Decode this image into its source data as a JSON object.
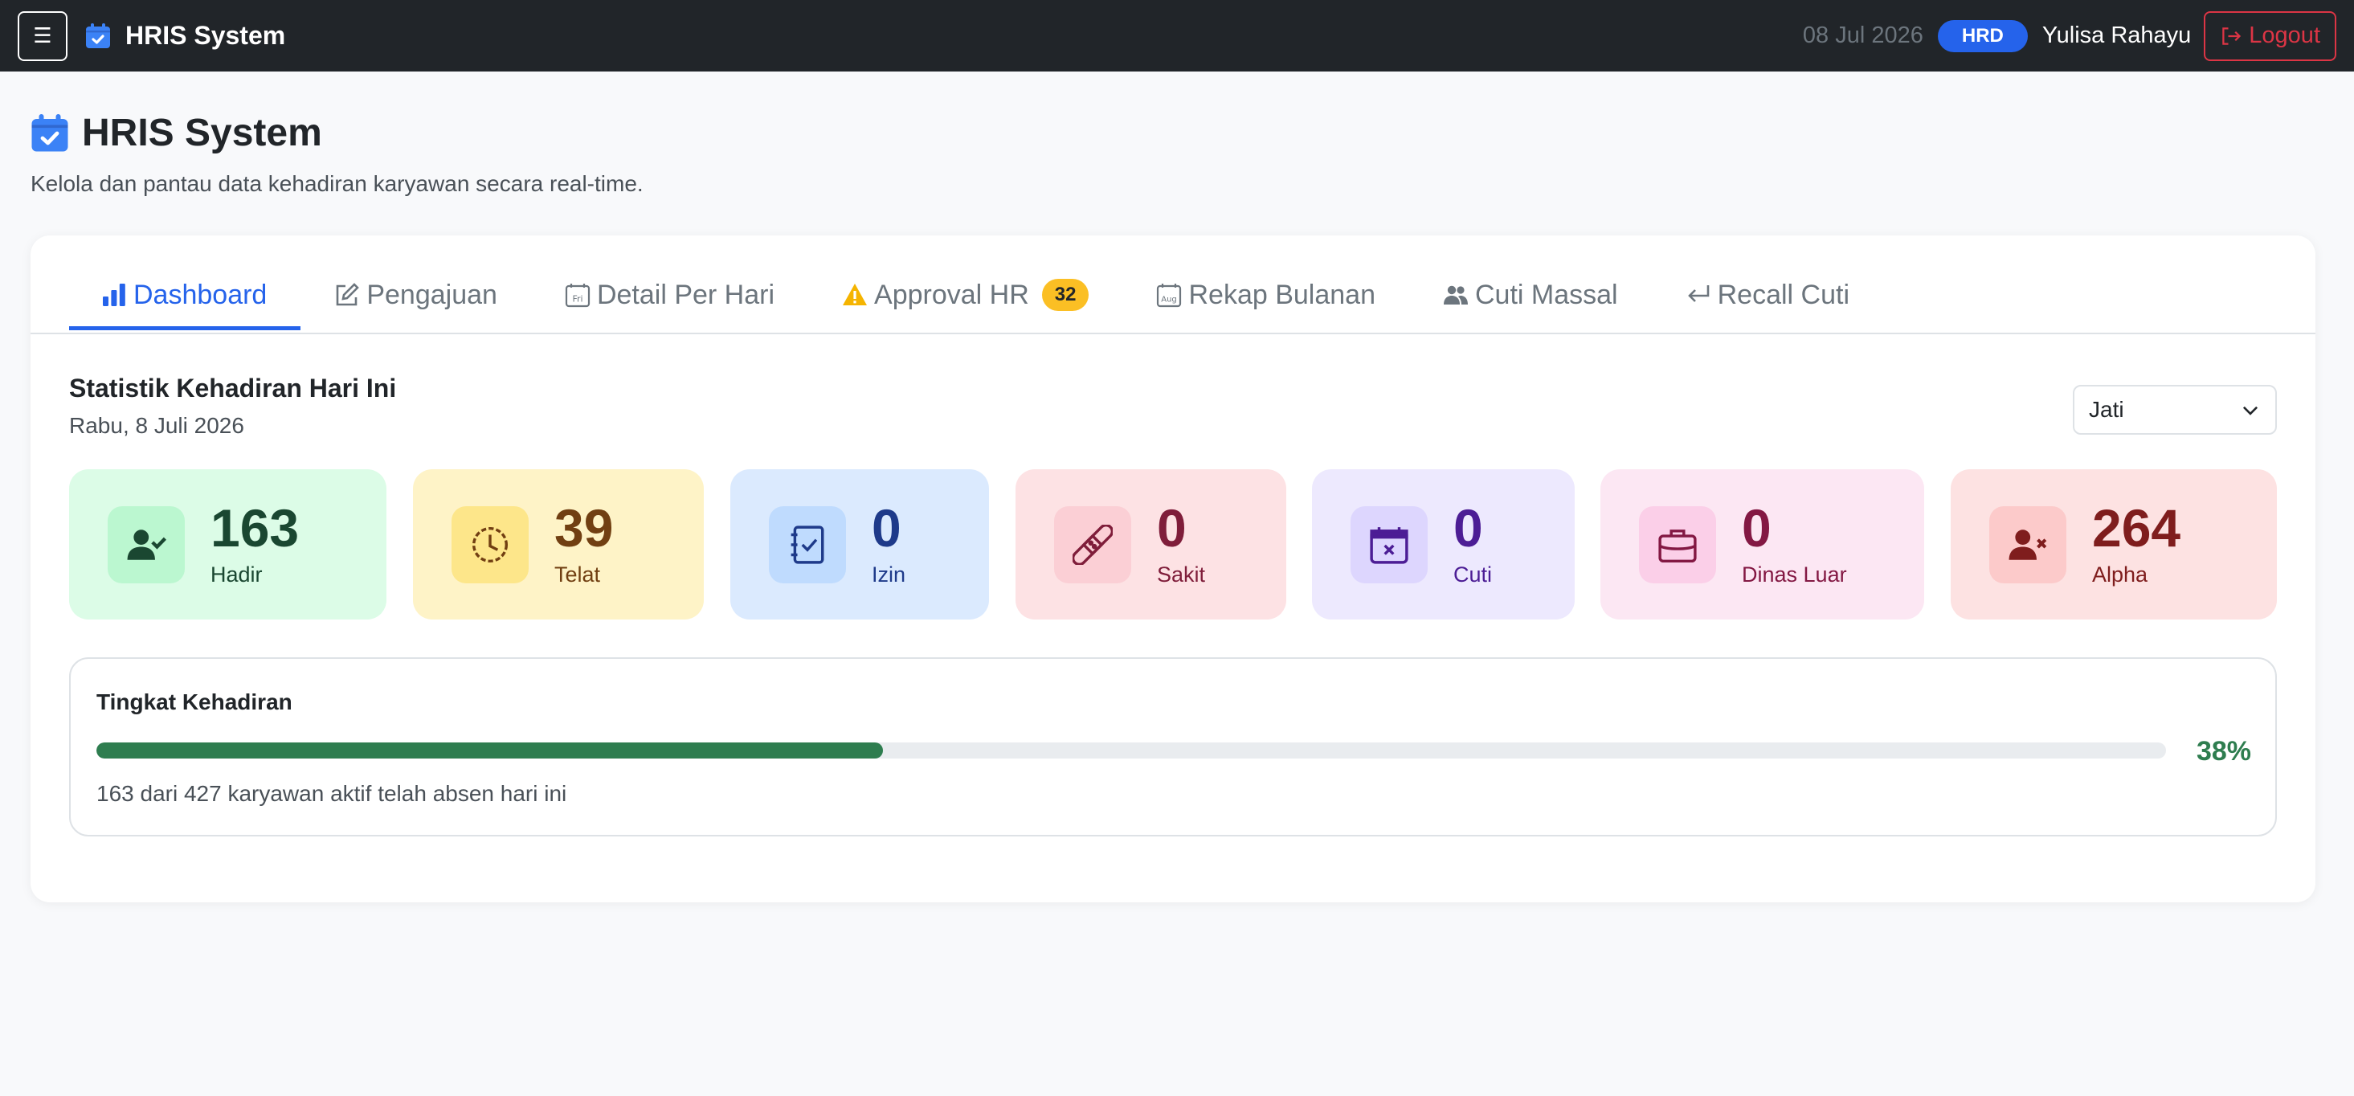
{
  "navbar": {
    "brand": "HRIS System",
    "date": "08 Jul 2026",
    "role": "HRD",
    "user": "Yulisa Rahayu",
    "logout": "Logout"
  },
  "page": {
    "title": "HRIS System",
    "subtitle": "Kelola dan pantau data kehadiran karyawan secara real-time."
  },
  "tabs": [
    {
      "label": "Dashboard",
      "icon": "bar-chart-icon",
      "active": true
    },
    {
      "label": "Pengajuan",
      "icon": "edit-icon"
    },
    {
      "label": "Detail Per Hari",
      "icon": "calendar-day-icon"
    },
    {
      "label": "Approval HR",
      "icon": "warning-icon",
      "badge": "32"
    },
    {
      "label": "Rekap Bulanan",
      "icon": "calendar-month-icon"
    },
    {
      "label": "Cuti Massal",
      "icon": "people-icon"
    },
    {
      "label": "Recall Cuti",
      "icon": "return-arrow-icon"
    }
  ],
  "stats": {
    "title": "Statistik Kehadiran Hari Ini",
    "date": "Rabu, 8 Juli 2026",
    "location_select": "Jati"
  },
  "tiles": [
    {
      "label": "Hadir",
      "value": "163",
      "icon": "user-check-icon",
      "bg": "#dcfce7",
      "icon_bg": "#bbf7d0",
      "color": "#1a4731"
    },
    {
      "label": "Telat",
      "value": "39",
      "icon": "clock-icon",
      "bg": "#fef3c7",
      "icon_bg": "#fde68a",
      "color": "#713f12"
    },
    {
      "label": "Izin",
      "value": "0",
      "icon": "journal-check-icon",
      "bg": "#dbeafe",
      "icon_bg": "#bfdbfe",
      "color": "#1e3a8a"
    },
    {
      "label": "Sakit",
      "value": "0",
      "icon": "bandage-icon",
      "bg": "#fde2e4",
      "icon_bg": "#fbcfd5",
      "color": "#7f1d3a"
    },
    {
      "label": "Cuti",
      "value": "0",
      "icon": "calendar-x-icon",
      "bg": "#ede9fe",
      "icon_bg": "#ddd6fe",
      "color": "#4c1d95"
    },
    {
      "label": "Dinas Luar",
      "value": "0",
      "icon": "briefcase-icon",
      "bg": "#fce7f3",
      "icon_bg": "#fbcfe8",
      "color": "#831843"
    },
    {
      "label": "Alpha",
      "value": "264",
      "icon": "user-x-icon",
      "bg": "#fde2e2",
      "icon_bg": "#fccaca",
      "color": "#7f1d1d"
    }
  ],
  "attendance": {
    "title": "Tingkat Kehadiran",
    "percent_label": "38%",
    "fill_fraction": 0.38,
    "note": "163 dari 427 karyawan aktif telah absen hari ini"
  }
}
